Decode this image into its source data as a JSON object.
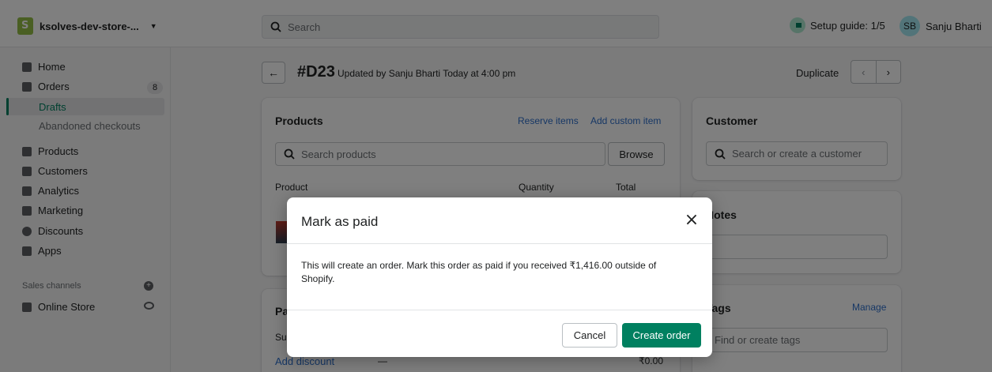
{
  "topbar": {
    "store_name": "ksolves-dev-store-...",
    "search_placeholder": "Search",
    "setup_guide": "Setup guide: 1/5",
    "user_initials": "SB",
    "user_name": "Sanju Bharti"
  },
  "sidebar": {
    "home": "Home",
    "orders": "Orders",
    "orders_count": "8",
    "drafts": "Drafts",
    "abandoned": "Abandoned checkouts",
    "products": "Products",
    "customers": "Customers",
    "analytics": "Analytics",
    "marketing": "Marketing",
    "discounts": "Discounts",
    "apps": "Apps",
    "sales_channels": "Sales channels",
    "online_store": "Online Store"
  },
  "header": {
    "title": "#D23",
    "subtitle": "Updated by Sanju Bharti Today at 4:00 pm",
    "duplicate": "Duplicate"
  },
  "products_card": {
    "title": "Products",
    "reserve_items": "Reserve items",
    "add_custom_item": "Add custom item",
    "search_placeholder": "Search products",
    "browse": "Browse",
    "col_product": "Product",
    "col_quantity": "Quantity",
    "col_total": "Total"
  },
  "payment_card": {
    "title_partial": "Pa",
    "subtotal_partial": "Su",
    "add_discount": "Add discount",
    "discount_dash": "—",
    "discount_value": "₹0.00"
  },
  "customer_card": {
    "title": "Customer",
    "search_placeholder": "Search or create a customer"
  },
  "notes_card": {
    "title": "Notes"
  },
  "tags_card": {
    "title": "Tags",
    "manage": "Manage",
    "placeholder": "Find or create tags"
  },
  "modal": {
    "title": "Mark as paid",
    "body": "This will create an order. Mark this order as paid if you received ₹1,416.00 outside of Shopify.",
    "cancel": "Cancel",
    "create_order": "Create order"
  },
  "colors": {
    "primary": "#008060",
    "link": "#2c6ecb"
  }
}
